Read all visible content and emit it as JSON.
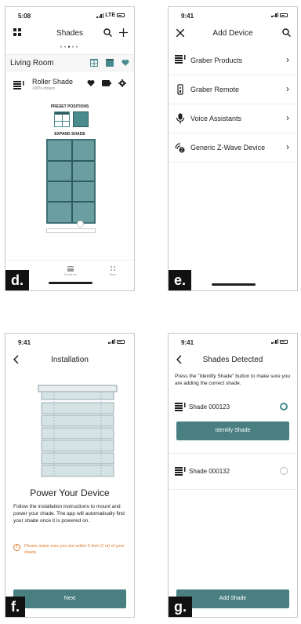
{
  "panels": {
    "d": {
      "label": "d.",
      "status": {
        "time": "5:08",
        "network": "LTE"
      },
      "title": "Shades",
      "room": "Living Room",
      "shade": {
        "name": "Roller Shade",
        "status": "100% closed"
      },
      "preset_label": "PRESET POSITIONS",
      "expand_label": "EXPAND SHADE",
      "tabs": [
        "Routines",
        "More"
      ],
      "colors": {
        "accent": "#4a8b8e"
      }
    },
    "e": {
      "label": "e.",
      "status": {
        "time": "9:41"
      },
      "title": "Add Device",
      "items": [
        {
          "label": "Graber Products",
          "icon": "shade-stack-icon"
        },
        {
          "label": "Graber Remote",
          "icon": "remote-icon"
        },
        {
          "label": "Voice Assistants",
          "icon": "microphone-icon"
        },
        {
          "label": "Generic Z-Wave Device",
          "icon": "zwave-icon"
        }
      ]
    },
    "f": {
      "label": "f.",
      "status": {
        "time": "9:41"
      },
      "title": "Installation",
      "heading": "Power Your Device",
      "body": "Follow the installation instructions to mount and power your shade. The app will automatically find your shade once it is powered on.",
      "warning": "Please make sure you are within 6 feet (2 m) of your shade.",
      "button": "Next",
      "colors": {
        "warning": "#e07a2e"
      }
    },
    "g": {
      "label": "g.",
      "status": {
        "time": "9:41"
      },
      "title": "Shades Detected",
      "instructions": "Press the \"Identify Shade\" button to make sure you are adding the correct shade.",
      "shades": [
        {
          "name": "Shade 000123",
          "selected": true
        },
        {
          "name": "Shade 000132",
          "selected": false
        }
      ],
      "identify_button": "Identify Shade",
      "add_button": "Add Shade"
    }
  }
}
